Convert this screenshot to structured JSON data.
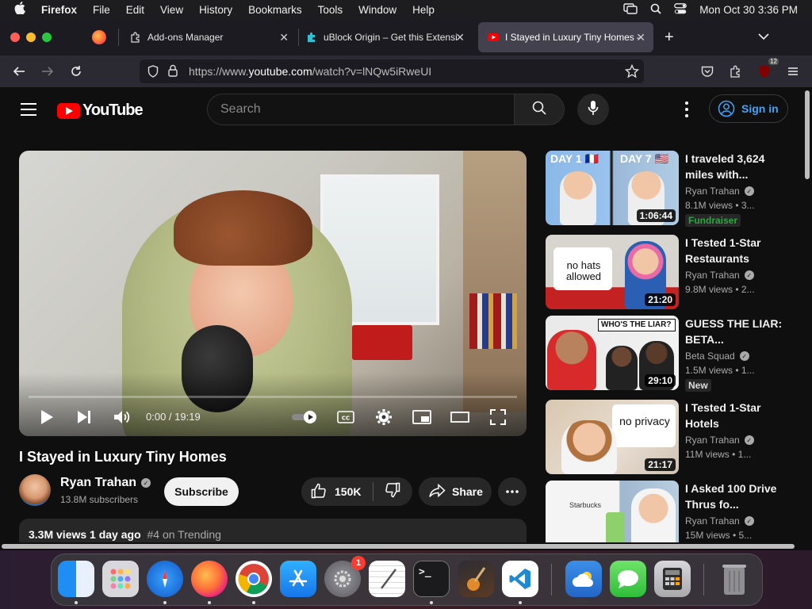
{
  "menubar": {
    "app": "Firefox",
    "items": [
      "File",
      "Edit",
      "View",
      "History",
      "Bookmarks",
      "Tools",
      "Window",
      "Help"
    ],
    "datetime": "Mon Oct 30  3:36 PM"
  },
  "tabs": [
    {
      "label": "Add-ons Manager",
      "active": false
    },
    {
      "label": "uBlock Origin – Get this Extensi",
      "active": false
    },
    {
      "label": "I Stayed in Luxury Tiny Homes –",
      "active": true
    }
  ],
  "navbar": {
    "url_prefix": "https://www.",
    "url_domain": "youtube.com",
    "url_path": "/watch?v=lNQw5iRweUI",
    "ext_badge": "12"
  },
  "youtube": {
    "logo_text": "YouTube",
    "search_placeholder": "Search",
    "signin_label": "Sign in",
    "player": {
      "time": "0:00 / 19:19",
      "progress": 0
    },
    "video": {
      "title": "I Stayed in Luxury Tiny Homes",
      "channel": "Ryan Trahan",
      "subscribers": "13.8M subscribers",
      "subscribe_label": "Subscribe",
      "likes": "150K",
      "share_label": "Share",
      "views_date": "3.3M views  1 day ago",
      "trending": "#4 on Trending"
    },
    "recommendations": [
      {
        "title": "I traveled 3,624 miles with...",
        "channel": "Ryan Trahan",
        "views": "8.1M views • 3...",
        "duration": "1:06:44",
        "badge": "Fundraiser",
        "thumb_text_a": "DAY 1 🇫🇷",
        "thumb_text_b": "DAY 7 🇺🇸"
      },
      {
        "title": "I Tested 1-Star Restaurants",
        "channel": "Ryan Trahan",
        "views": "9.8M views • 2...",
        "duration": "21:20",
        "badge": "",
        "thumb_text_a": "no hats allowed",
        "thumb_text_b": ""
      },
      {
        "title": "GUESS THE LIAR: BETA...",
        "channel": "Beta Squad",
        "views": "1.5M views • 1...",
        "duration": "29:10",
        "badge": "New",
        "thumb_text_a": "WHO'S THE LIAR?",
        "thumb_text_b": ""
      },
      {
        "title": "I Tested 1-Star Hotels",
        "channel": "Ryan Trahan",
        "views": "11M views • 1...",
        "duration": "21:17",
        "badge": "",
        "thumb_text_a": "no privacy",
        "thumb_text_b": ""
      },
      {
        "title": "I Asked 100 Drive Thrus fo...",
        "channel": "Ryan Trahan",
        "views": "15M views • 5...",
        "duration": "",
        "badge": "",
        "thumb_text_a": "Starbucks",
        "thumb_text_b": ""
      }
    ]
  },
  "dock": {
    "settings_badge": "1"
  },
  "colors": {
    "yt_red": "#ff0000",
    "link_blue": "#3ea6ff",
    "fundraiser_green": "#2ba640"
  }
}
